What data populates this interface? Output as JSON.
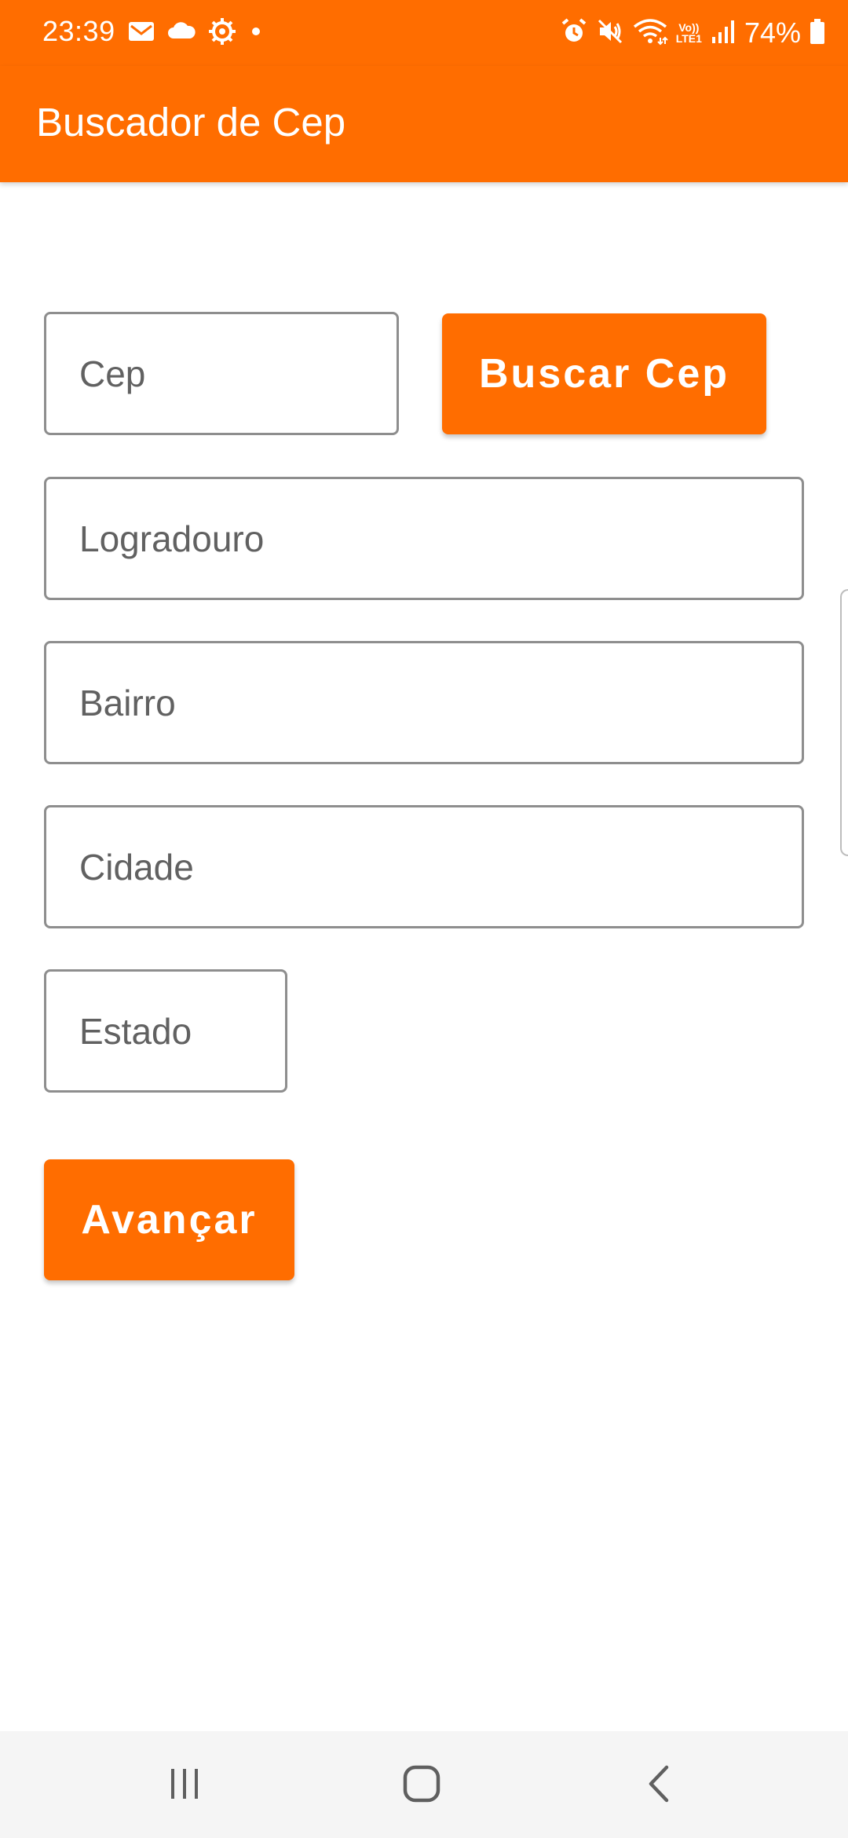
{
  "status_bar": {
    "time": "23:39",
    "battery": "74%",
    "icons_left": [
      "mail-icon",
      "cloud-icon",
      "gear-icon",
      "dot-icon"
    ],
    "icons_right": [
      "alarm-icon",
      "mute-icon",
      "wifi-icon",
      "volte-icon",
      "signal-icon",
      "battery-icon"
    ],
    "volte_label_top": "Vo))",
    "volte_label_bottom": "LTE1"
  },
  "app_bar": {
    "title": "Buscador de Cep"
  },
  "form": {
    "cep": {
      "placeholder": "Cep",
      "value": ""
    },
    "buscar_button_label": "Buscar Cep",
    "logradouro": {
      "placeholder": "Logradouro",
      "value": ""
    },
    "bairro": {
      "placeholder": "Bairro",
      "value": ""
    },
    "cidade": {
      "placeholder": "Cidade",
      "value": ""
    },
    "estado": {
      "placeholder": "Estado",
      "value": ""
    },
    "avancar_button_label": "Avançar"
  },
  "nav_bar": {
    "buttons": [
      "recent-apps-icon",
      "home-icon",
      "back-icon"
    ]
  },
  "colors": {
    "accent": "#FF6D00",
    "field_border": "#8E8E8E",
    "background": "#FFFFFF",
    "nav_background": "#F5F5F5"
  }
}
